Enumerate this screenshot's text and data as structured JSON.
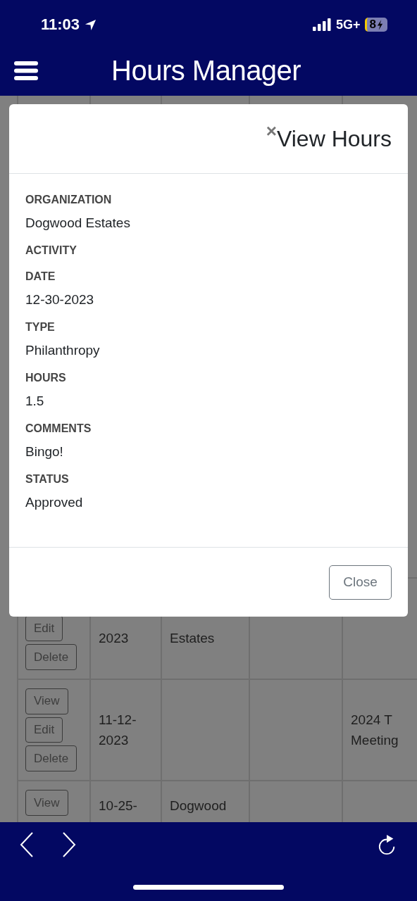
{
  "status_bar": {
    "time": "11:03",
    "network": "5G+",
    "battery": "8"
  },
  "header": {
    "title": "Hours Manager"
  },
  "background_table": {
    "rows": [
      {
        "buttons": [
          "Edit",
          "Delete"
        ],
        "cells": [
          "2023",
          "Estates",
          "",
          ""
        ]
      },
      {
        "buttons": [
          "View",
          "Edit",
          "Delete"
        ],
        "cells": [
          "11-12-\n2023",
          "",
          "",
          "2024 T\nMeeting"
        ]
      },
      {
        "buttons": [
          "View"
        ],
        "cells": [
          "10-25-",
          "Dogwood",
          "",
          ""
        ]
      }
    ]
  },
  "modal": {
    "close_icon": "×",
    "title": "View Hours",
    "fields": [
      {
        "label": "ORGANIZATION",
        "value": "Dogwood Estates"
      },
      {
        "label": "ACTIVITY"
      },
      {
        "label": "DATE",
        "value": "12-30-2023"
      },
      {
        "label": "TYPE",
        "value": "Philanthropy"
      },
      {
        "label": "HOURS",
        "value": "1.5"
      },
      {
        "label": "COMMENTS",
        "value": "Bingo!"
      },
      {
        "label": "STATUS",
        "value": "Approved"
      }
    ],
    "close_button": "Close"
  }
}
